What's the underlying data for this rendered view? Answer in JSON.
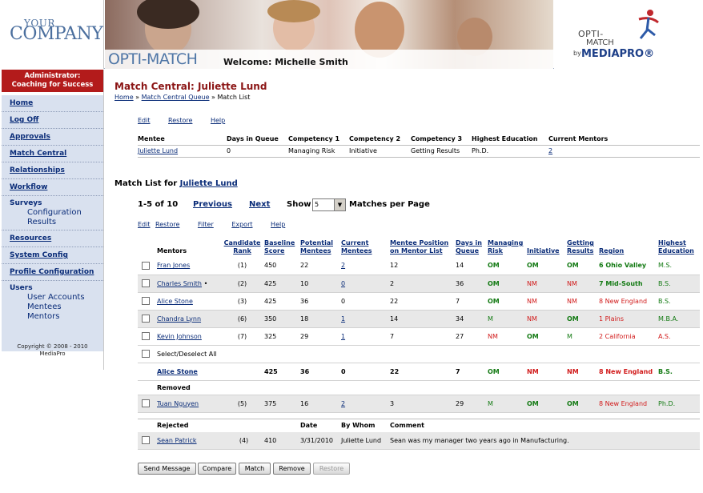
{
  "header": {
    "logo_your": "YOUR",
    "logo_company": "COMPANY",
    "app_name": "OPTI-MATCH",
    "welcome": "Welcome: Michelle Smith",
    "brand_opti": "OPTI-",
    "brand_match": "MATCH",
    "brand_by": "by",
    "brand_mediapro": "MEDIAPRO®"
  },
  "sidebar": {
    "admin_line1": "Administrator:",
    "admin_line2": "Coaching for Success",
    "items": [
      {
        "label": "Home"
      },
      {
        "label": "Log Off"
      },
      {
        "label": "Approvals"
      },
      {
        "label": "Match Central"
      },
      {
        "label": "Relationships"
      },
      {
        "label": "Workflow"
      }
    ],
    "surveys": {
      "label": "Surveys",
      "subs": [
        "Configuration",
        "Results"
      ]
    },
    "items2": [
      {
        "label": "Resources"
      },
      {
        "label": "System Config"
      },
      {
        "label": "Profile Configuration"
      }
    ],
    "users": {
      "label": "Users",
      "subs": [
        "User Accounts",
        "Mentees",
        "Mentors"
      ]
    },
    "copyright_line1": "Copyright © 2008 - 2010",
    "copyright_line2": "MediaPro"
  },
  "main": {
    "title": "Match Central: Juliette Lund",
    "breadcrumb": {
      "home": "Home",
      "sep1": " » ",
      "queue": "Match Central Queue",
      "sep2": " » ",
      "current": "Match List"
    },
    "mentee_actions": [
      "Edit",
      "Restore",
      "Help"
    ],
    "mentee_table": {
      "headers": [
        "Mentee",
        "Days in Queue",
        "Competency 1",
        "Competency 2",
        "Competency 3",
        "Highest Education",
        "Current Mentors"
      ],
      "row": [
        "Juliette Lund",
        "0",
        "Managing Risk",
        "Initiative",
        "Getting Results",
        "Ph.D.",
        "2"
      ]
    },
    "matchlist_label": "Match List for ",
    "matchlist_name": "Juliette Lund",
    "pager": {
      "range": "1-5 of 10",
      "previous": "Previous",
      "next": "Next",
      "show": "Show",
      "show_value": "5",
      "per_page": "Matches per Page"
    },
    "list_actions": [
      "Edit",
      "Restore",
      "Filter",
      "Export",
      "Help"
    ],
    "mentor_headers": {
      "mentors": "Mentors",
      "rank1": "Candidate",
      "rank2": "Rank",
      "score1": "Baseline",
      "score2": "Score",
      "pot1": "Potential",
      "pot2": "Mentees",
      "cur1": "Current",
      "cur2": "Mentees",
      "pos1": "Mentee Position",
      "pos2": "on Mentor List",
      "days1": "Days in",
      "days2": "Queue",
      "risk1": "Managing",
      "risk2": "Risk",
      "init": "Initiative",
      "res1": "Getting",
      "res2": "Results",
      "region": "Region",
      "edu1": "Highest",
      "edu2": "Education"
    },
    "mentors": [
      {
        "name": "Fran Jones",
        "mark": "",
        "rank": "(1)",
        "score": "450",
        "potential": "22",
        "current": "2",
        "position": "12",
        "days": "14",
        "risk": "OM",
        "initiative": "OM",
        "results": "OM",
        "region": "6 Ohio Valley",
        "education": "M.S."
      },
      {
        "name": "Charles Smith",
        "mark": "•",
        "rank": "(2)",
        "score": "425",
        "potential": "10",
        "current": "0",
        "position": "2",
        "days": "36",
        "risk": "OM",
        "initiative": "NM",
        "results": "NM",
        "region": "7 Mid-South",
        "education": "B.S."
      },
      {
        "name": "Alice Stone",
        "mark": "",
        "rank": "(3)",
        "score": "425",
        "potential": "36",
        "current": "0",
        "position": "22",
        "days": "7",
        "risk": "OM",
        "initiative": "NM",
        "results": "NM",
        "region": "8 New England",
        "education": "B.S."
      },
      {
        "name": "Chandra Lynn",
        "mark": "",
        "rank": "(6)",
        "score": "350",
        "potential": "18",
        "current": "1",
        "position": "14",
        "days": "34",
        "risk": "M",
        "initiative": "NM",
        "results": "OM",
        "region": "1 Plains",
        "education": "M.B.A."
      },
      {
        "name": "Kevin Johnson",
        "mark": "",
        "rank": "(7)",
        "score": "325",
        "potential": "29",
        "current": "1",
        "position": "7",
        "days": "27",
        "risk": "NM",
        "initiative": "OM",
        "results": "M",
        "region": "2 California",
        "education": "A.S."
      }
    ],
    "select_all": "Select/Deselect All",
    "selected": {
      "name": "Alice Stone",
      "score": "425",
      "potential": "36",
      "current": "0",
      "position": "22",
      "days": "7",
      "risk": "OM",
      "initiative": "NM",
      "results": "NM",
      "region": "8 New England",
      "education": "B.S."
    },
    "removed_label": "Removed",
    "removed": {
      "name": "Tuan Nguyen",
      "rank": "(5)",
      "score": "375",
      "potential": "16",
      "current": "2",
      "position": "3",
      "days": "29",
      "risk": "M",
      "initiative": "OM",
      "results": "OM",
      "region": "8 New England",
      "education": "Ph.D."
    },
    "rejected_headers": {
      "label": "Rejected",
      "date": "Date",
      "by": "By Whom",
      "comment": "Comment"
    },
    "rejected": {
      "name": "Sean Patrick",
      "rank": "(4)",
      "score": "410",
      "date": "3/31/2010",
      "by": "Juliette Lund",
      "comment": "Sean was my manager two years ago in Manufacturing."
    },
    "buttons": [
      "Send Message",
      "Compare",
      "Match",
      "Remove",
      "Restore"
    ]
  },
  "colors": {
    "accent_red": "#b31b1b",
    "title_red": "#8b1515",
    "link_blue": "#0a2c78",
    "om_green": "#137a13",
    "nm_red": "#d11a1a",
    "nav_bg": "#d9e1ef"
  }
}
